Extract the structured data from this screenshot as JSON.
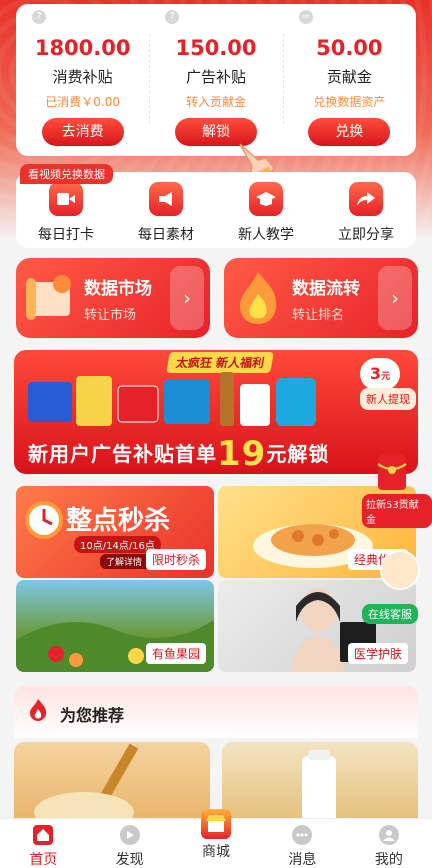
{
  "subsidy": [
    {
      "amount": "1800.00",
      "name": "消费补贴",
      "note": "已消费￥0.00",
      "button": "去消费"
    },
    {
      "amount": "150.00",
      "name": "广告补贴",
      "note": "转入贡献金",
      "button": "解锁"
    },
    {
      "amount": "50.00",
      "name": "贡献金",
      "note": "兑换数据资产",
      "button": "兑换"
    }
  ],
  "help_marks": [
    "?",
    "?",
    "="
  ],
  "quick": {
    "tag": "看视频兑换数据",
    "items": [
      {
        "label": "每日打卡",
        "icon": "video-icon"
      },
      {
        "label": "每日素材",
        "icon": "megaphone-icon"
      },
      {
        "label": "新人教学",
        "icon": "graduation-cap-icon"
      },
      {
        "label": "立即分享",
        "icon": "share-icon"
      }
    ]
  },
  "market": [
    {
      "title": "数据市场",
      "subtitle": "转让市场",
      "arrow": "›"
    },
    {
      "title": "数据流转",
      "subtitle": "转让排名",
      "arrow": "›"
    }
  ],
  "promo": {
    "tag": "太疯狂 新人福利",
    "text_before": "新用户广告补贴首单",
    "big": "19",
    "text_after": "元解锁",
    "badge_num": "3",
    "badge_unit": "元",
    "withdraw": "新人提现"
  },
  "float": {
    "invite": "拉新53贡献金",
    "service": "在线客服"
  },
  "tiles": [
    {
      "title": "整点秒杀",
      "times": "10点/14点/16点",
      "more": "了解详情 >",
      "label": "限时秒杀"
    },
    {
      "label": "经典优选"
    },
    {
      "label": "有鱼果园"
    },
    {
      "label": "医学护肤"
    }
  ],
  "recommend": {
    "title": "为您推荐"
  },
  "tabs": [
    {
      "label": "首页",
      "icon": "home-icon",
      "active": true
    },
    {
      "label": "发现",
      "icon": "play-icon"
    },
    {
      "label": "商城",
      "icon": "store-icon"
    },
    {
      "label": "消息",
      "icon": "message-icon"
    },
    {
      "label": "我的",
      "icon": "user-icon"
    }
  ],
  "colors": {
    "brand": "#e5222a",
    "accent_orange": "#ff8a3c",
    "service_green": "#1fb45a"
  }
}
